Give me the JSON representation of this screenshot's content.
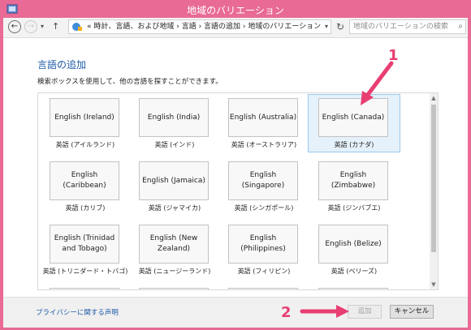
{
  "window": {
    "title": "地域のバリエーション",
    "accent": "#e86a95"
  },
  "address": {
    "path_prefix": "«",
    "crumbs": "時計、言語、および地域  ›  言語  ›  言語の追加  ›  地域のバリエーション",
    "search_placeholder": "地域のバリエーションの検索"
  },
  "content": {
    "heading": "言語の追加",
    "instruction": "検索ボックスを使用して、他の言語を探すことができます。"
  },
  "tiles": [
    {
      "box": "English (Ireland)",
      "caption": "英語 (アイルランド)"
    },
    {
      "box": "English (India)",
      "caption": "英語 (インド)"
    },
    {
      "box": "English (Australia)",
      "caption": "英語 (オーストラリア)"
    },
    {
      "box": "English (Canada)",
      "caption": "英語 (カナダ)"
    },
    {
      "box": "English (Caribbean)",
      "caption": "英語 (カリブ)"
    },
    {
      "box": "English (Jamaica)",
      "caption": "英語 (ジャマイカ)"
    },
    {
      "box": "English (Singapore)",
      "caption": "英語 (シンガポール)"
    },
    {
      "box": "English (Zimbabwe)",
      "caption": "英語 (ジンバブエ)"
    },
    {
      "box": "English (Trinidad and Tobago)",
      "caption": "英語 (トリニダード・トバゴ)"
    },
    {
      "box": "English (New Zealand)",
      "caption": "英語 (ニュージーランド)"
    },
    {
      "box": "English (Philippines)",
      "caption": "英語 (フィリピン)"
    },
    {
      "box": "English (Belize)",
      "caption": "英語 (ベリーズ)"
    }
  ],
  "selected_tile": "English (Canada)",
  "footer": {
    "privacy_link": "プライバシーに関する声明",
    "add_button": "追加",
    "cancel_button": "キャンセル"
  },
  "annotations": {
    "step1": "1",
    "step2": "2",
    "color": "#e83e72"
  }
}
